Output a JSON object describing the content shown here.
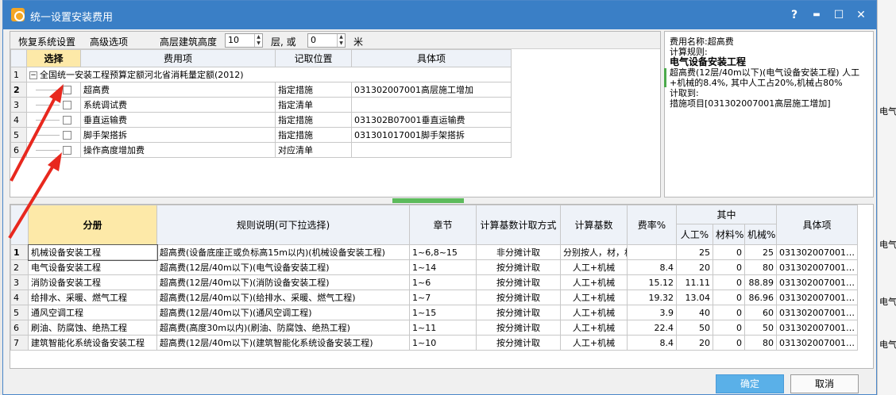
{
  "dialog": {
    "title": "统一设置安装费用",
    "help": "?",
    "minimize": "▬",
    "maximize": "☐",
    "close": "✕"
  },
  "toolbar": {
    "restore": "恢复系统设置",
    "advanced": "高级选项",
    "height_label": "高层建筑高度",
    "height_value": "10",
    "floors_label": "层, 或",
    "meters_value": "0",
    "meters_unit": "米"
  },
  "top_table": {
    "headers": [
      "选择",
      "费用项",
      "记取位置",
      "具体项"
    ],
    "group_row": "全国统一安装工程预算定额河北省消耗量定额(2012)",
    "rows": [
      {
        "n": "2",
        "name": "超高费",
        "pos": "指定措施",
        "item": "031302007001高层施工增加"
      },
      {
        "n": "3",
        "name": "系统调试费",
        "pos": "指定清单",
        "item": ""
      },
      {
        "n": "4",
        "name": "垂直运输费",
        "pos": "指定措施",
        "item": "031302B07001垂直运输费"
      },
      {
        "n": "5",
        "name": "脚手架搭拆",
        "pos": "指定措施",
        "item": "031301017001脚手架搭拆"
      },
      {
        "n": "6",
        "name": "操作高度增加费",
        "pos": "对应清单",
        "item": ""
      }
    ]
  },
  "side": {
    "line1": "费用名称:超高费",
    "line2": "计算规则:",
    "line3": "电气设备安装工程",
    "line4": "超高费(12层/40m以下)(电气设备安装工程) 人工+机械的8.4%, 其中人工占20%,机械占80%",
    "line5": "计取到:",
    "line6": "措施项目[031302007001高层施工增加]"
  },
  "bottom_table": {
    "headers": {
      "book": "分册",
      "rule": "规则说明(可下拉选择)",
      "chapter": "章节",
      "method": "计算基数计取方式",
      "base": "计算基数",
      "rate": "费率%",
      "among": "其中",
      "labor": "人工%",
      "material": "材料%",
      "machine": "机械%",
      "item": "具体项"
    },
    "rows": [
      {
        "n": "1",
        "book": "机械设备安装工程",
        "rule": "超高费(设备底座正或负标高15m以内)(机械设备安装工程)",
        "chapter": "1~6,8~15",
        "method": "非分摊计取",
        "base": "分别按人，材，机取费",
        "rate": "",
        "labor": "25",
        "material": "0",
        "machine": "25",
        "item": "031302007001…"
      },
      {
        "n": "2",
        "book": "电气设备安装工程",
        "rule": "超高费(12层/40m以下)(电气设备安装工程)",
        "chapter": "1~14",
        "method": "按分摊计取",
        "base": "人工+机械",
        "rate": "8.4",
        "labor": "20",
        "material": "0",
        "machine": "80",
        "item": "031302007001…"
      },
      {
        "n": "3",
        "book": "消防设备安装工程",
        "rule": "超高费(12层/40m以下)(消防设备安装工程)",
        "chapter": "1~6",
        "method": "按分摊计取",
        "base": "人工+机械",
        "rate": "15.12",
        "labor": "11.11",
        "material": "0",
        "machine": "88.89",
        "item": "031302007001…"
      },
      {
        "n": "4",
        "book": "给排水、采暖、燃气工程",
        "rule": "超高费(12层/40m以下)(给排水、采暖、燃气工程)",
        "chapter": "1~7",
        "method": "按分摊计取",
        "base": "人工+机械",
        "rate": "19.32",
        "labor": "13.04",
        "material": "0",
        "machine": "86.96",
        "item": "031302007001…"
      },
      {
        "n": "5",
        "book": "通风空调工程",
        "rule": "超高费(12层/40m以下)(通风空调工程)",
        "chapter": "1~15",
        "method": "按分摊计取",
        "base": "人工+机械",
        "rate": "3.9",
        "labor": "40",
        "material": "0",
        "machine": "60",
        "item": "031302007001…"
      },
      {
        "n": "6",
        "book": "刷油、防腐蚀、绝热工程",
        "rule": "超高费(高度30m以内)(刷油、防腐蚀、绝热工程)",
        "chapter": "1~11",
        "method": "按分摊计取",
        "base": "人工+机械",
        "rate": "22.4",
        "labor": "50",
        "material": "0",
        "machine": "50",
        "item": "031302007001…"
      },
      {
        "n": "7",
        "book": "建筑智能化系统设备安装工程",
        "rule": "超高费(12层/40m以下)(建筑智能化系统设备安装工程)",
        "chapter": "1~10",
        "method": "按分摊计取",
        "base": "人工+机械",
        "rate": "8.4",
        "labor": "20",
        "material": "0",
        "machine": "80",
        "item": "031302007001…"
      }
    ]
  },
  "buttons": {
    "ok": "确定",
    "cancel": "取消"
  },
  "background": {
    "t1": "电气",
    "t2": "电气",
    "t3": "电气",
    "t4": "电气"
  }
}
